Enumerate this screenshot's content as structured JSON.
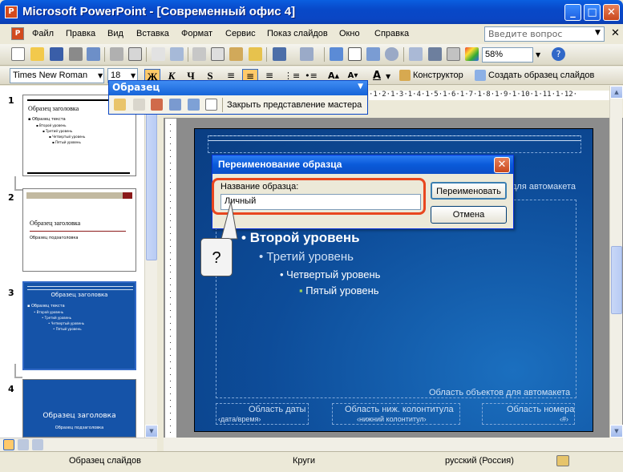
{
  "window": {
    "title": "Microsoft PowerPoint - [Современный офис 4]",
    "controls": {
      "minimize": "_",
      "maximize": "□",
      "close": "✕"
    }
  },
  "menu": {
    "items": [
      "Файл",
      "Правка",
      "Вид",
      "Вставка",
      "Формат",
      "Сервис",
      "Показ слайдов",
      "Окно",
      "Справка"
    ],
    "help_placeholder": "Введите вопрос",
    "close_glyph": "✕"
  },
  "toolbar_standard": {
    "zoom": "58%"
  },
  "toolbar_format": {
    "font": "Times New Roman",
    "size": "18",
    "bold": "Ж",
    "italic": "К",
    "underline": "Ч",
    "shadow": "S",
    "constructor": "Конструктор",
    "create_master": "Создать образец слайдов"
  },
  "master_toolbar": {
    "title": "Образец",
    "close_view": "Закрыть представление мастера"
  },
  "ruler": {
    "marks": "·1·2·1·3·1·4·1·5·1·6·1·7·1·8·1·9·1·10·1·11·1·12·"
  },
  "thumbnails": [
    {
      "num": "1",
      "title": "Образец заголовка",
      "body": [
        "Образец текста",
        "Второй уровень",
        "Третий уровень",
        "Четвертый уровень",
        "Пятый уровень"
      ]
    },
    {
      "num": "2",
      "title": "Образец заголовка",
      "body": [
        "Образец подзаголовка"
      ]
    },
    {
      "num": "3",
      "title": "Образец заголовка",
      "body": [
        "Образец текста",
        "Второй уровень",
        "Третий уровень",
        "Четвертый уровень",
        "Пятый уровень"
      ]
    },
    {
      "num": "4",
      "title": "Образец заголовка",
      "body": [
        "Образец подзаголовка"
      ]
    }
  ],
  "slide": {
    "level2": "Второй уровень",
    "level3": "Третий уровень",
    "level4": "Четвертый уровень",
    "level5": "Пятый уровень",
    "objects_area": "Область объектов для автомакета",
    "objects_area_top": "для автомакета",
    "date_area": "Область даты",
    "date_field": "‹дата/время›",
    "footer_area": "Область ниж. колонтитула",
    "footer_field": "‹нижний колонтитул›",
    "number_area": "Область номера",
    "number_field": "‹#›"
  },
  "dialog": {
    "title": "Переименование образца",
    "label": "Название образца:",
    "value": "Личный",
    "rename": "Переименовать",
    "cancel": "Отмена",
    "close_glyph": "✕"
  },
  "callout": {
    "text": "?"
  },
  "status": {
    "view": "Образец слайдов",
    "design": "Круги",
    "language": "русский (Россия)"
  },
  "colors": {
    "accent": "#0a46c4",
    "slide_bg": "#0d4c99",
    "highlight": "#e8461e"
  }
}
